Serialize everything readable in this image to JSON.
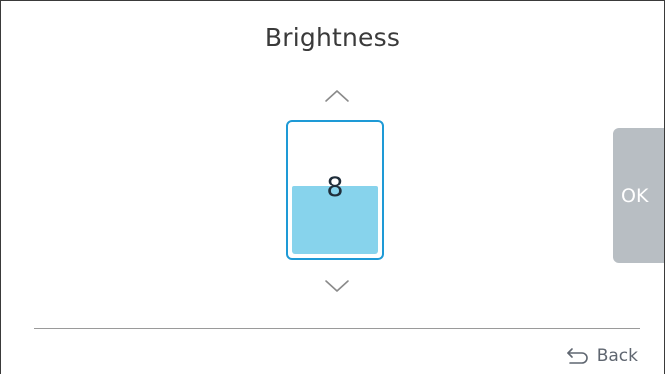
{
  "screen": {
    "title": "Brightness"
  },
  "level": {
    "value": "8",
    "fill_fraction": 0.53,
    "colors": {
      "border": "#1e9ad6",
      "fill": "#87d3ec"
    }
  },
  "controls": {
    "up_icon": "chevron-up-icon",
    "down_icon": "chevron-down-icon",
    "ok_label": "OK",
    "ok_color": "#b8bec3"
  },
  "footer": {
    "back_label": "Back",
    "back_icon": "back-arrow-icon"
  }
}
